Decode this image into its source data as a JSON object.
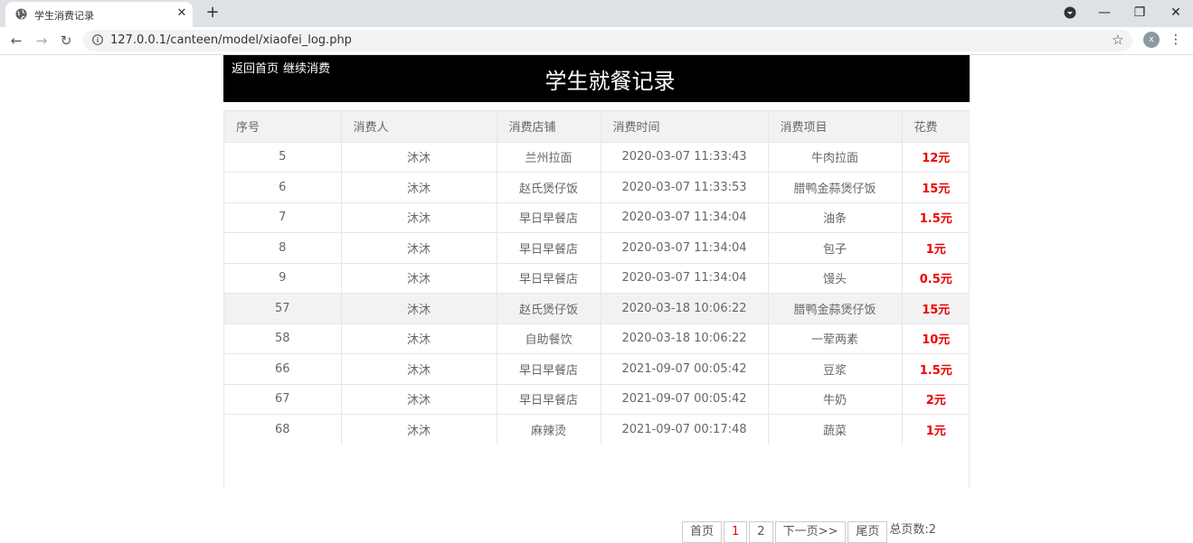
{
  "browser": {
    "tab_title": "学生消费记录",
    "url": "127.0.0.1/canteen/model/xiaofei_log.php",
    "profile_initial": "x"
  },
  "header": {
    "link_home": "返回首页",
    "link_continue": "继续消费",
    "title": "学生就餐记录"
  },
  "table": {
    "columns": [
      "序号",
      "消费人",
      "消费店铺",
      "消费时间",
      "消费项目",
      "花费"
    ],
    "rows": [
      [
        "5",
        "沐沐",
        "兰州拉面",
        "2020-03-07 11:33:43",
        "牛肉拉面",
        "12元"
      ],
      [
        "6",
        "沐沐",
        "赵氏煲仔饭",
        "2020-03-07 11:33:53",
        "腊鸭金蒜煲仔饭",
        "15元"
      ],
      [
        "7",
        "沐沐",
        "早日早餐店",
        "2020-03-07 11:34:04",
        "油条",
        "1.5元"
      ],
      [
        "8",
        "沐沐",
        "早日早餐店",
        "2020-03-07 11:34:04",
        "包子",
        "1元"
      ],
      [
        "9",
        "沐沐",
        "早日早餐店",
        "2020-03-07 11:34:04",
        "馒头",
        "0.5元"
      ],
      [
        "57",
        "沐沐",
        "赵氏煲仔饭",
        "2020-03-18 10:06:22",
        "腊鸭金蒜煲仔饭",
        "15元"
      ],
      [
        "58",
        "沐沐",
        "自助餐饮",
        "2020-03-18 10:06:22",
        "一荤两素",
        "10元"
      ],
      [
        "66",
        "沐沐",
        "早日早餐店",
        "2021-09-07 00:05:42",
        "豆浆",
        "1.5元"
      ],
      [
        "67",
        "沐沐",
        "早日早餐店",
        "2021-09-07 00:05:42",
        "牛奶",
        "2元"
      ],
      [
        "68",
        "沐沐",
        "麻辣烫",
        "2021-09-07 00:17:48",
        "蔬菜",
        "1元"
      ]
    ],
    "highlighted_row": 5
  },
  "pager": {
    "first": "首页",
    "pages": [
      "1",
      "2"
    ],
    "current": "1",
    "next": "下一页>>",
    "last": "尾页",
    "total": "总页数:2"
  },
  "colors": {
    "cost": "#e00000",
    "header_bg": "#000000",
    "row_highlight": "#f2f2f2"
  }
}
